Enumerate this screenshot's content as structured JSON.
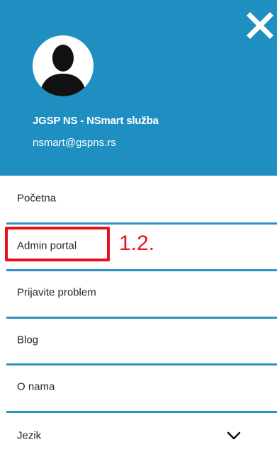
{
  "header": {
    "user_name": "JGSP NS - NSmart služba",
    "user_email": "nsmart@gspns.rs",
    "background_color": "#1f8fc2",
    "close_icon": "close-icon",
    "avatar_icon": "user-silhouette-icon"
  },
  "menu": {
    "items": [
      {
        "label": "Početna"
      },
      {
        "label": "Admin portal"
      },
      {
        "label": "Prijavite problem"
      },
      {
        "label": "Blog"
      },
      {
        "label": "O nama"
      },
      {
        "label": "Jezik",
        "icon": "chevron-down-icon"
      }
    ]
  },
  "annotation": {
    "text": "1.2.",
    "color": "#e8121b"
  }
}
